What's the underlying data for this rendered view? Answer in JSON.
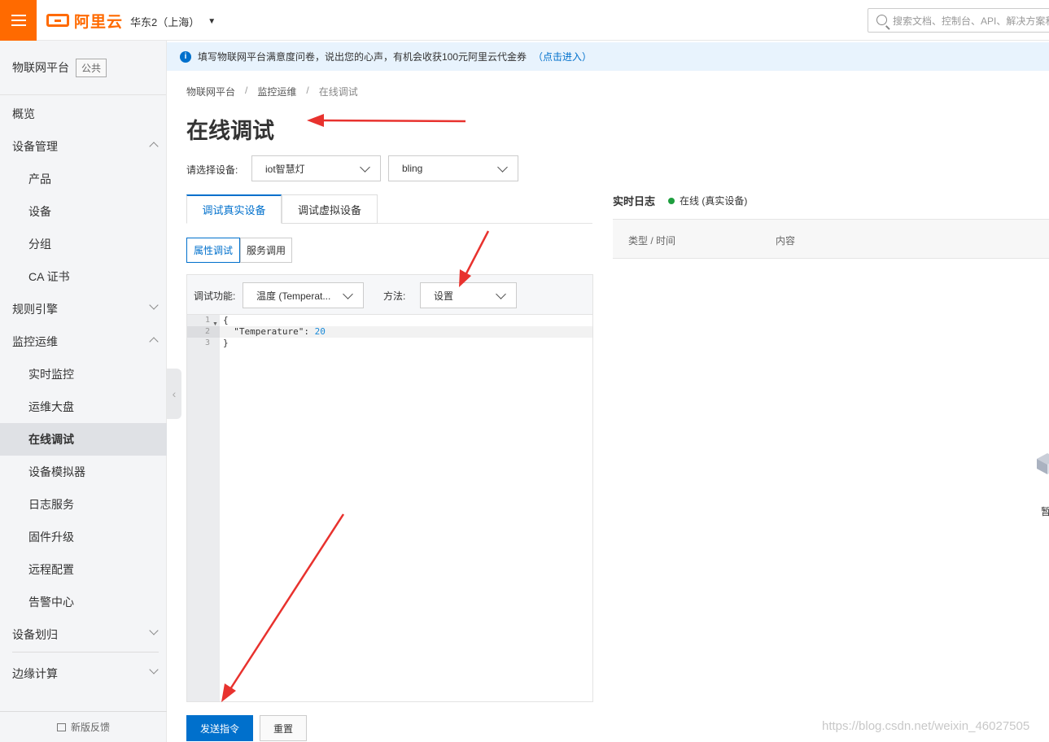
{
  "topbar": {
    "logo_text": "阿里云",
    "region": "华东2（上海）",
    "search_placeholder": "搜索文档、控制台、API、解决方案和资源"
  },
  "sidebar": {
    "title": "物联网平台",
    "badge": "公共",
    "items": [
      {
        "label": "概览",
        "level": 1
      },
      {
        "label": "设备管理",
        "level": 1,
        "chevron": "up"
      },
      {
        "label": "产品",
        "level": 2
      },
      {
        "label": "设备",
        "level": 2
      },
      {
        "label": "分组",
        "level": 2
      },
      {
        "label": "CA 证书",
        "level": 2
      },
      {
        "label": "规则引擎",
        "level": 1,
        "chevron": "down"
      },
      {
        "label": "监控运维",
        "level": 1,
        "chevron": "up"
      },
      {
        "label": "实时监控",
        "level": 2
      },
      {
        "label": "运维大盘",
        "level": 2
      },
      {
        "label": "在线调试",
        "level": 2,
        "active": true
      },
      {
        "label": "设备模拟器",
        "level": 2
      },
      {
        "label": "日志服务",
        "level": 2
      },
      {
        "label": "固件升级",
        "level": 2
      },
      {
        "label": "远程配置",
        "level": 2
      },
      {
        "label": "告警中心",
        "level": 2
      },
      {
        "label": "设备划归",
        "level": 1,
        "chevron": "down"
      },
      {
        "label": "边缘计算",
        "level": 1,
        "chevron": "down"
      }
    ],
    "footer": "新版反馈"
  },
  "notice": {
    "text": "填写物联网平台满意度问卷，说出您的心声，有机会收获100元阿里云代金券",
    "link": "（点击进入）"
  },
  "breadcrumb": [
    "物联网平台",
    "监控运维",
    "在线调试"
  ],
  "page_title": "在线调试",
  "device_select": {
    "label": "请选择设备:",
    "product": "iot智慧灯",
    "device": "bling"
  },
  "tabs": [
    "调试真实设备",
    "调试虚拟设备"
  ],
  "subtabs": [
    "属性调试",
    "服务调用"
  ],
  "debug": {
    "function_label": "调试功能:",
    "function_value": "温度 (Temperat...",
    "method_label": "方法:",
    "method_value": "设置",
    "code_lines": [
      "{",
      "  \"Temperature\": ",
      "}"
    ],
    "code_value": "20"
  },
  "log": {
    "title": "实时日志",
    "status": "在线 (真实设备)",
    "col_type": "类型 / 时间",
    "col_content": "内容",
    "empty_text": "暂"
  },
  "buttons": {
    "send": "发送指令",
    "reset": "重置"
  },
  "watermark": "https://blog.csdn.net/weixin_46027505",
  "colors": {
    "brand_orange": "#ff6a00",
    "primary_blue": "#0070cc",
    "online_green": "#1e9e3e",
    "annotation_red": "#e8322e"
  }
}
